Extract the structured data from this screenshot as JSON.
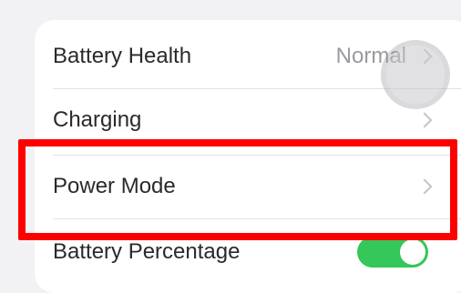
{
  "settings": {
    "rows": [
      {
        "label": "Battery Health",
        "value": "Normal"
      },
      {
        "label": "Charging"
      },
      {
        "label": "Power Mode"
      },
      {
        "label": "Battery Percentage",
        "toggle_on": true
      }
    ]
  },
  "colors": {
    "highlight": "#ff0000",
    "toggle_on": "#34c759"
  }
}
